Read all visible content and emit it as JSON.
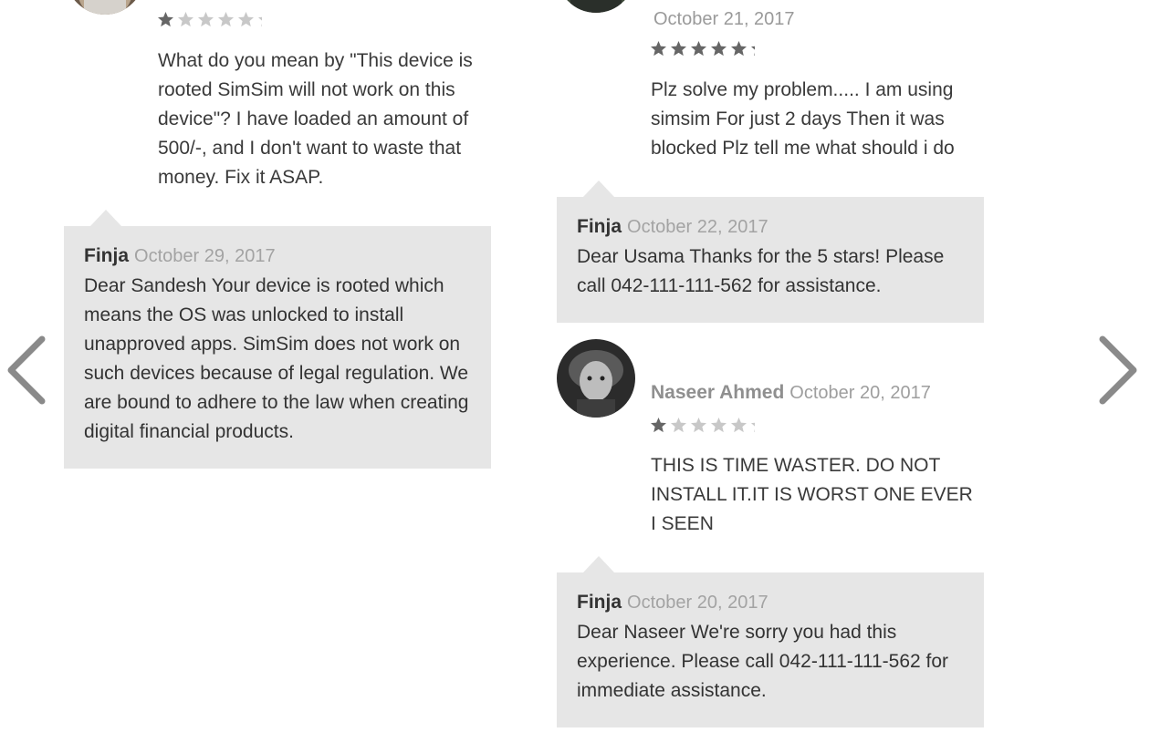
{
  "navigation": {
    "prev_icon": "chevron-left-icon",
    "next_icon": "chevron-right-icon"
  },
  "colors": {
    "reply_background": "#e6e6e6",
    "star_filled": "#666666",
    "star_empty": "#c8c8c8",
    "arrow": "#8a8a8a"
  },
  "reviews": [
    {
      "name": "",
      "date": "",
      "rating": 1,
      "text": "What do you mean by \"This device is rooted SimSim will not work on this device\"? I have loaded an amount of 500/-, and I don't want to waste that money. Fix it ASAP.",
      "reply": {
        "author": "Finja",
        "date": "October 29, 2017",
        "text": "Dear Sandesh Your device is rooted which means the OS was unlocked to install unapproved apps. SimSim does not work on such devices because of legal regulation. We are bound to adhere to the law when creating digital financial products."
      }
    },
    {
      "name": "",
      "date": "October 21, 2017",
      "rating": 5,
      "text": "Plz solve my problem..... I am using simsim For just 2 days Then it was blocked Plz tell me what should i do",
      "reply": {
        "author": "Finja",
        "date": "October 22, 2017",
        "text": "Dear Usama Thanks for the 5 stars! Please call 042-111-111-562 for assistance."
      }
    },
    {
      "name": "Naseer Ahmed",
      "date": "October 20, 2017",
      "rating": 1,
      "text": "THIS IS TIME WASTER. DO NOT INSTALL IT.IT IS WORST ONE EVER I SEEN",
      "reply": {
        "author": "Finja",
        "date": "October 20, 2017",
        "text": "Dear Naseer We're sorry you had this experience. Please call 042-111-111-562 for immediate assistance."
      }
    }
  ]
}
